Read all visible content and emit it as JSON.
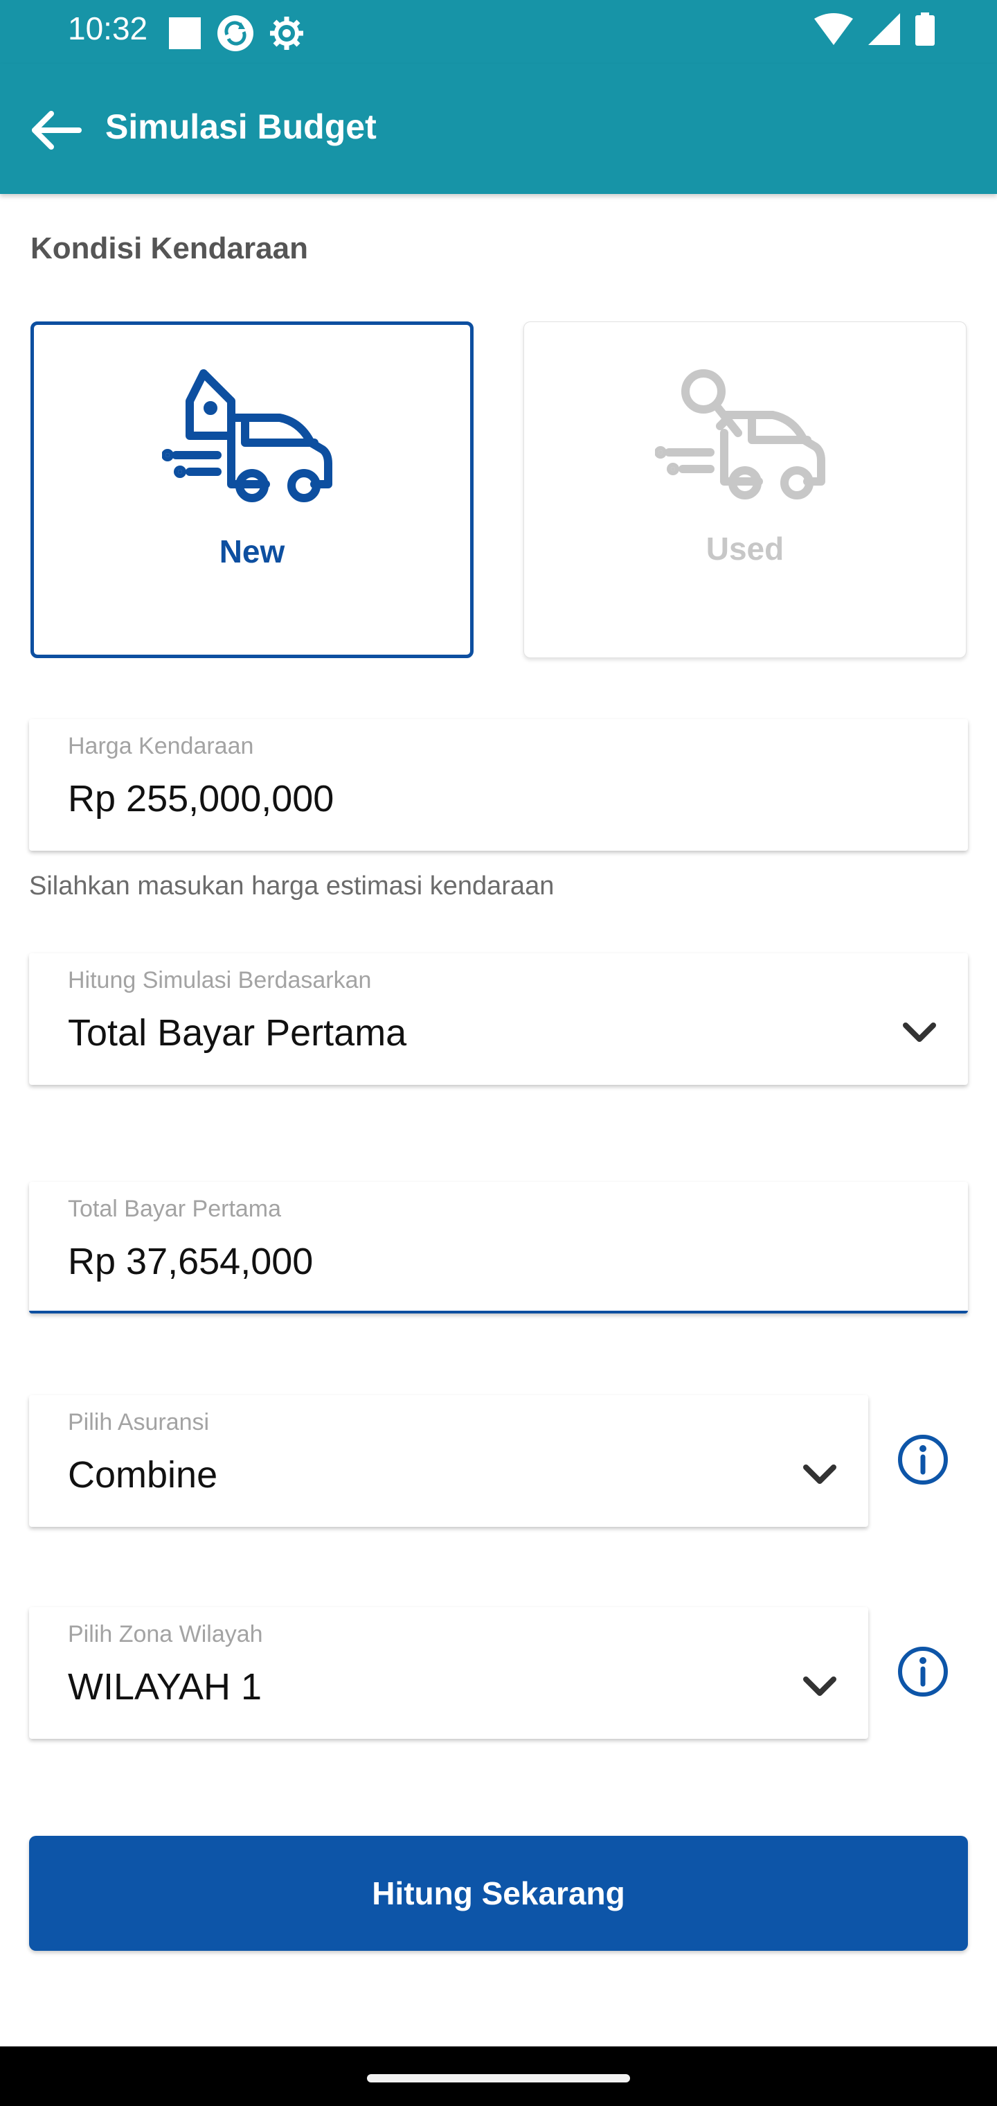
{
  "status_bar": {
    "time": "10:32",
    "left_icons": [
      "notification-square-icon",
      "sync-icon",
      "settings-gear-icon"
    ],
    "right_icons": [
      "wifi-icon",
      "cell-signal-icon",
      "battery-icon"
    ]
  },
  "app_bar": {
    "title": "Simulasi Budget",
    "back_icon": "arrow-left-icon"
  },
  "section": {
    "title": "Kondisi Kendaraan"
  },
  "conditions": [
    {
      "label": "New",
      "icon": "new-vehicle-tag-icon",
      "selected": true
    },
    {
      "label": "Used",
      "icon": "used-vehicle-key-icon",
      "selected": false
    }
  ],
  "price_field": {
    "label": "Harga Kendaraan",
    "value": "Rp 255,000,000",
    "helper": "Silahkan masukan harga estimasi kendaraan"
  },
  "simulation_field": {
    "label": "Hitung Simulasi Berdasarkan",
    "value": "Total Bayar Pertama"
  },
  "down_payment_field": {
    "label": "Total Bayar Pertama",
    "value": "Rp 37,654,000"
  },
  "insurance_field": {
    "label": "Pilih Asuransi",
    "value": "Combine"
  },
  "zone_field": {
    "label": "Pilih Zona Wilayah",
    "value": "WILAYAH 1"
  },
  "cta": {
    "label": "Hitung Sekarang"
  },
  "colors": {
    "app_bar": "#1794a7",
    "primary": "#0d55a8",
    "selected_border": "#0d4fa0",
    "muted": "#c7c7c7"
  }
}
